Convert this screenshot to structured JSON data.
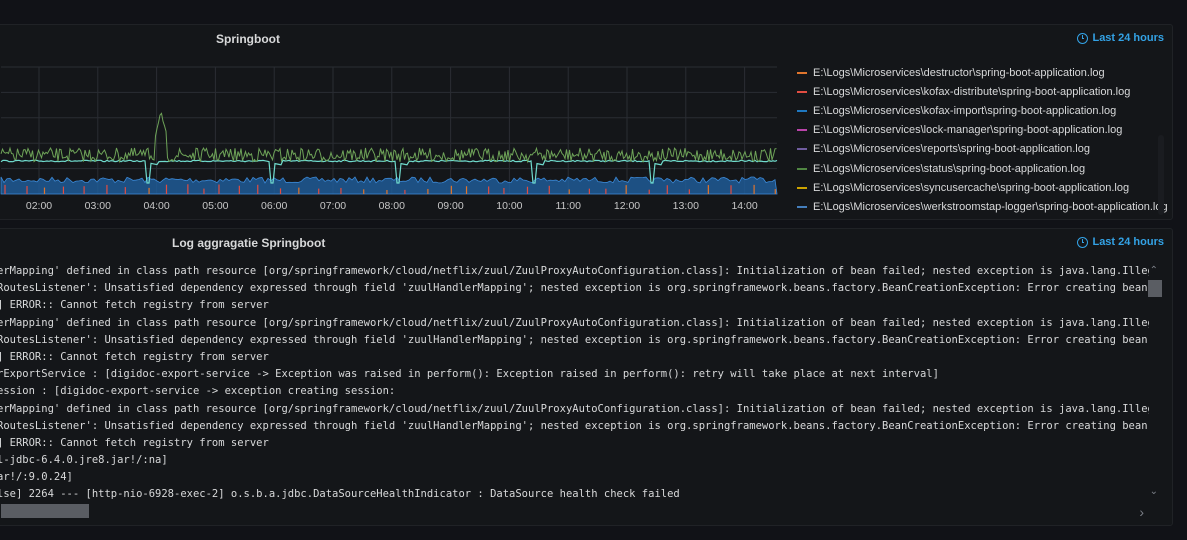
{
  "top_panel": {
    "title": "Springboot",
    "time_range": "Last 24 hours",
    "legend": [
      {
        "label": "E:\\Logs\\Microservices\\destructor\\spring-boot-application.log",
        "color": "#e0752d"
      },
      {
        "label": "E:\\Logs\\Microservices\\kofax-distribute\\spring-boot-application.log",
        "color": "#e24d42"
      },
      {
        "label": "E:\\Logs\\Microservices\\kofax-import\\spring-boot-application.log",
        "color": "#1f78c1"
      },
      {
        "label": "E:\\Logs\\Microservices\\lock-manager\\spring-boot-application.log",
        "color": "#ba43a9"
      },
      {
        "label": "E:\\Logs\\Microservices\\reports\\spring-boot-application.log",
        "color": "#705da0"
      },
      {
        "label": "E:\\Logs\\Microservices\\status\\spring-boot-application.log",
        "color": "#508642"
      },
      {
        "label": "E:\\Logs\\Microservices\\syncusercache\\spring-boot-application.log",
        "color": "#cca300"
      },
      {
        "label": "E:\\Logs\\Microservices\\werkstroomstap-logger\\spring-boot-application.log",
        "color": "#447ebc"
      }
    ]
  },
  "chart_data": {
    "type": "line",
    "x_ticks": [
      "02:00",
      "03:00",
      "04:00",
      "05:00",
      "06:00",
      "07:00",
      "08:00",
      "09:00",
      "10:00",
      "11:00",
      "12:00",
      "13:00",
      "14:00"
    ],
    "grid": true,
    "series_colors": {
      "status": "#508642",
      "teal": "#70dbcd",
      "blue": "#1f78c1",
      "red": "#e24d42"
    }
  },
  "bottom_panel": {
    "title": "Log aggragatie Springboot",
    "time_range": "Last 24 hours",
    "lines": [
      "erMapping' defined in class path resource [org/springframework/cloud/netflix/zuul/ZuulProxyAutoConfiguration.class]: Initialization of bean failed; nested exception is java.lang.IllegalStateEx",
      "RoutesListener': Unsatisfied dependency expressed through field 'zuulHandlerMapping'; nested exception is org.springframework.beans.factory.BeanCreationException: Error creating bean with name",
      "] ERROR:: Cannot fetch registry from server",
      "erMapping' defined in class path resource [org/springframework/cloud/netflix/zuul/ZuulProxyAutoConfiguration.class]: Initialization of bean failed; nested exception is java.lang.IllegalStateEx",
      "RoutesListener': Unsatisfied dependency expressed through field 'zuulHandlerMapping'; nested exception is org.springframework.beans.factory.BeanCreationException: Error creating bean with name",
      "] ERROR:: Cannot fetch registry from server",
      "rExportService : [digidoc-export-service -> Exception was raised in perform(): Exception raised in perform(): retry will take place at next interval]",
      "ession : [digidoc-export-service -> exception creating session:",
      "erMapping' defined in class path resource [org/springframework/cloud/netflix/zuul/ZuulProxyAutoConfiguration.class]: Initialization of bean failed; nested exception is java.lang.IllegalStateEx",
      "RoutesListener': Unsatisfied dependency expressed through field 'zuulHandlerMapping'; nested exception is org.springframework.beans.factory.BeanCreationException: Error creating bean with name",
      "] ERROR:: Cannot fetch registry from server",
      "l-jdbc-6.4.0.jre8.jar!/:na]",
      "ar!/:9.0.24]",
      "lse] 2264 --- [http-nio-6928-exec-2] o.s.b.a.jdbc.DataSourceHealthIndicator : DataSource health check failed"
    ]
  }
}
